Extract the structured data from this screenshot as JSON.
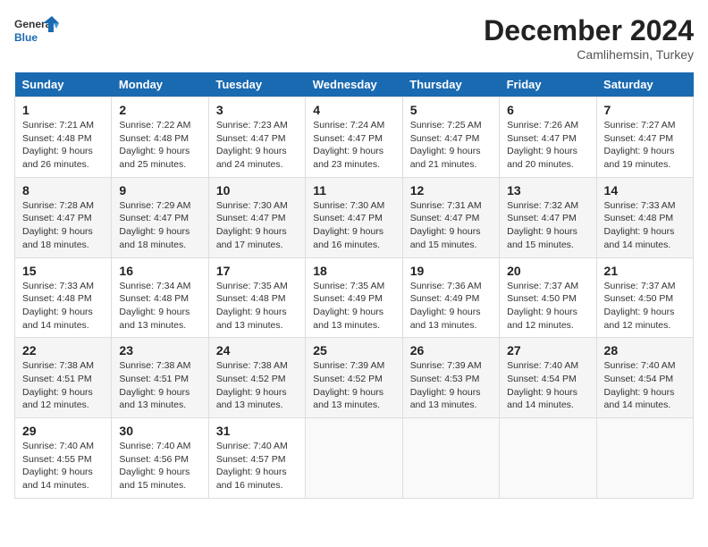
{
  "header": {
    "logo_line1": "General",
    "logo_line2": "Blue",
    "title": "December 2024",
    "subtitle": "Camlihemsin, Turkey"
  },
  "weekdays": [
    "Sunday",
    "Monday",
    "Tuesday",
    "Wednesday",
    "Thursday",
    "Friday",
    "Saturday"
  ],
  "weeks": [
    [
      {
        "day": "1",
        "info": "Sunrise: 7:21 AM\nSunset: 4:48 PM\nDaylight: 9 hours\nand 26 minutes."
      },
      {
        "day": "2",
        "info": "Sunrise: 7:22 AM\nSunset: 4:48 PM\nDaylight: 9 hours\nand 25 minutes."
      },
      {
        "day": "3",
        "info": "Sunrise: 7:23 AM\nSunset: 4:47 PM\nDaylight: 9 hours\nand 24 minutes."
      },
      {
        "day": "4",
        "info": "Sunrise: 7:24 AM\nSunset: 4:47 PM\nDaylight: 9 hours\nand 23 minutes."
      },
      {
        "day": "5",
        "info": "Sunrise: 7:25 AM\nSunset: 4:47 PM\nDaylight: 9 hours\nand 21 minutes."
      },
      {
        "day": "6",
        "info": "Sunrise: 7:26 AM\nSunset: 4:47 PM\nDaylight: 9 hours\nand 20 minutes."
      },
      {
        "day": "7",
        "info": "Sunrise: 7:27 AM\nSunset: 4:47 PM\nDaylight: 9 hours\nand 19 minutes."
      }
    ],
    [
      {
        "day": "8",
        "info": "Sunrise: 7:28 AM\nSunset: 4:47 PM\nDaylight: 9 hours\nand 18 minutes."
      },
      {
        "day": "9",
        "info": "Sunrise: 7:29 AM\nSunset: 4:47 PM\nDaylight: 9 hours\nand 18 minutes."
      },
      {
        "day": "10",
        "info": "Sunrise: 7:30 AM\nSunset: 4:47 PM\nDaylight: 9 hours\nand 17 minutes."
      },
      {
        "day": "11",
        "info": "Sunrise: 7:30 AM\nSunset: 4:47 PM\nDaylight: 9 hours\nand 16 minutes."
      },
      {
        "day": "12",
        "info": "Sunrise: 7:31 AM\nSunset: 4:47 PM\nDaylight: 9 hours\nand 15 minutes."
      },
      {
        "day": "13",
        "info": "Sunrise: 7:32 AM\nSunset: 4:47 PM\nDaylight: 9 hours\nand 15 minutes."
      },
      {
        "day": "14",
        "info": "Sunrise: 7:33 AM\nSunset: 4:48 PM\nDaylight: 9 hours\nand 14 minutes."
      }
    ],
    [
      {
        "day": "15",
        "info": "Sunrise: 7:33 AM\nSunset: 4:48 PM\nDaylight: 9 hours\nand 14 minutes."
      },
      {
        "day": "16",
        "info": "Sunrise: 7:34 AM\nSunset: 4:48 PM\nDaylight: 9 hours\nand 13 minutes."
      },
      {
        "day": "17",
        "info": "Sunrise: 7:35 AM\nSunset: 4:48 PM\nDaylight: 9 hours\nand 13 minutes."
      },
      {
        "day": "18",
        "info": "Sunrise: 7:35 AM\nSunset: 4:49 PM\nDaylight: 9 hours\nand 13 minutes."
      },
      {
        "day": "19",
        "info": "Sunrise: 7:36 AM\nSunset: 4:49 PM\nDaylight: 9 hours\nand 13 minutes."
      },
      {
        "day": "20",
        "info": "Sunrise: 7:37 AM\nSunset: 4:50 PM\nDaylight: 9 hours\nand 12 minutes."
      },
      {
        "day": "21",
        "info": "Sunrise: 7:37 AM\nSunset: 4:50 PM\nDaylight: 9 hours\nand 12 minutes."
      }
    ],
    [
      {
        "day": "22",
        "info": "Sunrise: 7:38 AM\nSunset: 4:51 PM\nDaylight: 9 hours\nand 12 minutes."
      },
      {
        "day": "23",
        "info": "Sunrise: 7:38 AM\nSunset: 4:51 PM\nDaylight: 9 hours\nand 13 minutes."
      },
      {
        "day": "24",
        "info": "Sunrise: 7:38 AM\nSunset: 4:52 PM\nDaylight: 9 hours\nand 13 minutes."
      },
      {
        "day": "25",
        "info": "Sunrise: 7:39 AM\nSunset: 4:52 PM\nDaylight: 9 hours\nand 13 minutes."
      },
      {
        "day": "26",
        "info": "Sunrise: 7:39 AM\nSunset: 4:53 PM\nDaylight: 9 hours\nand 13 minutes."
      },
      {
        "day": "27",
        "info": "Sunrise: 7:40 AM\nSunset: 4:54 PM\nDaylight: 9 hours\nand 14 minutes."
      },
      {
        "day": "28",
        "info": "Sunrise: 7:40 AM\nSunset: 4:54 PM\nDaylight: 9 hours\nand 14 minutes."
      }
    ],
    [
      {
        "day": "29",
        "info": "Sunrise: 7:40 AM\nSunset: 4:55 PM\nDaylight: 9 hours\nand 14 minutes."
      },
      {
        "day": "30",
        "info": "Sunrise: 7:40 AM\nSunset: 4:56 PM\nDaylight: 9 hours\nand 15 minutes."
      },
      {
        "day": "31",
        "info": "Sunrise: 7:40 AM\nSunset: 4:57 PM\nDaylight: 9 hours\nand 16 minutes."
      },
      null,
      null,
      null,
      null
    ]
  ]
}
